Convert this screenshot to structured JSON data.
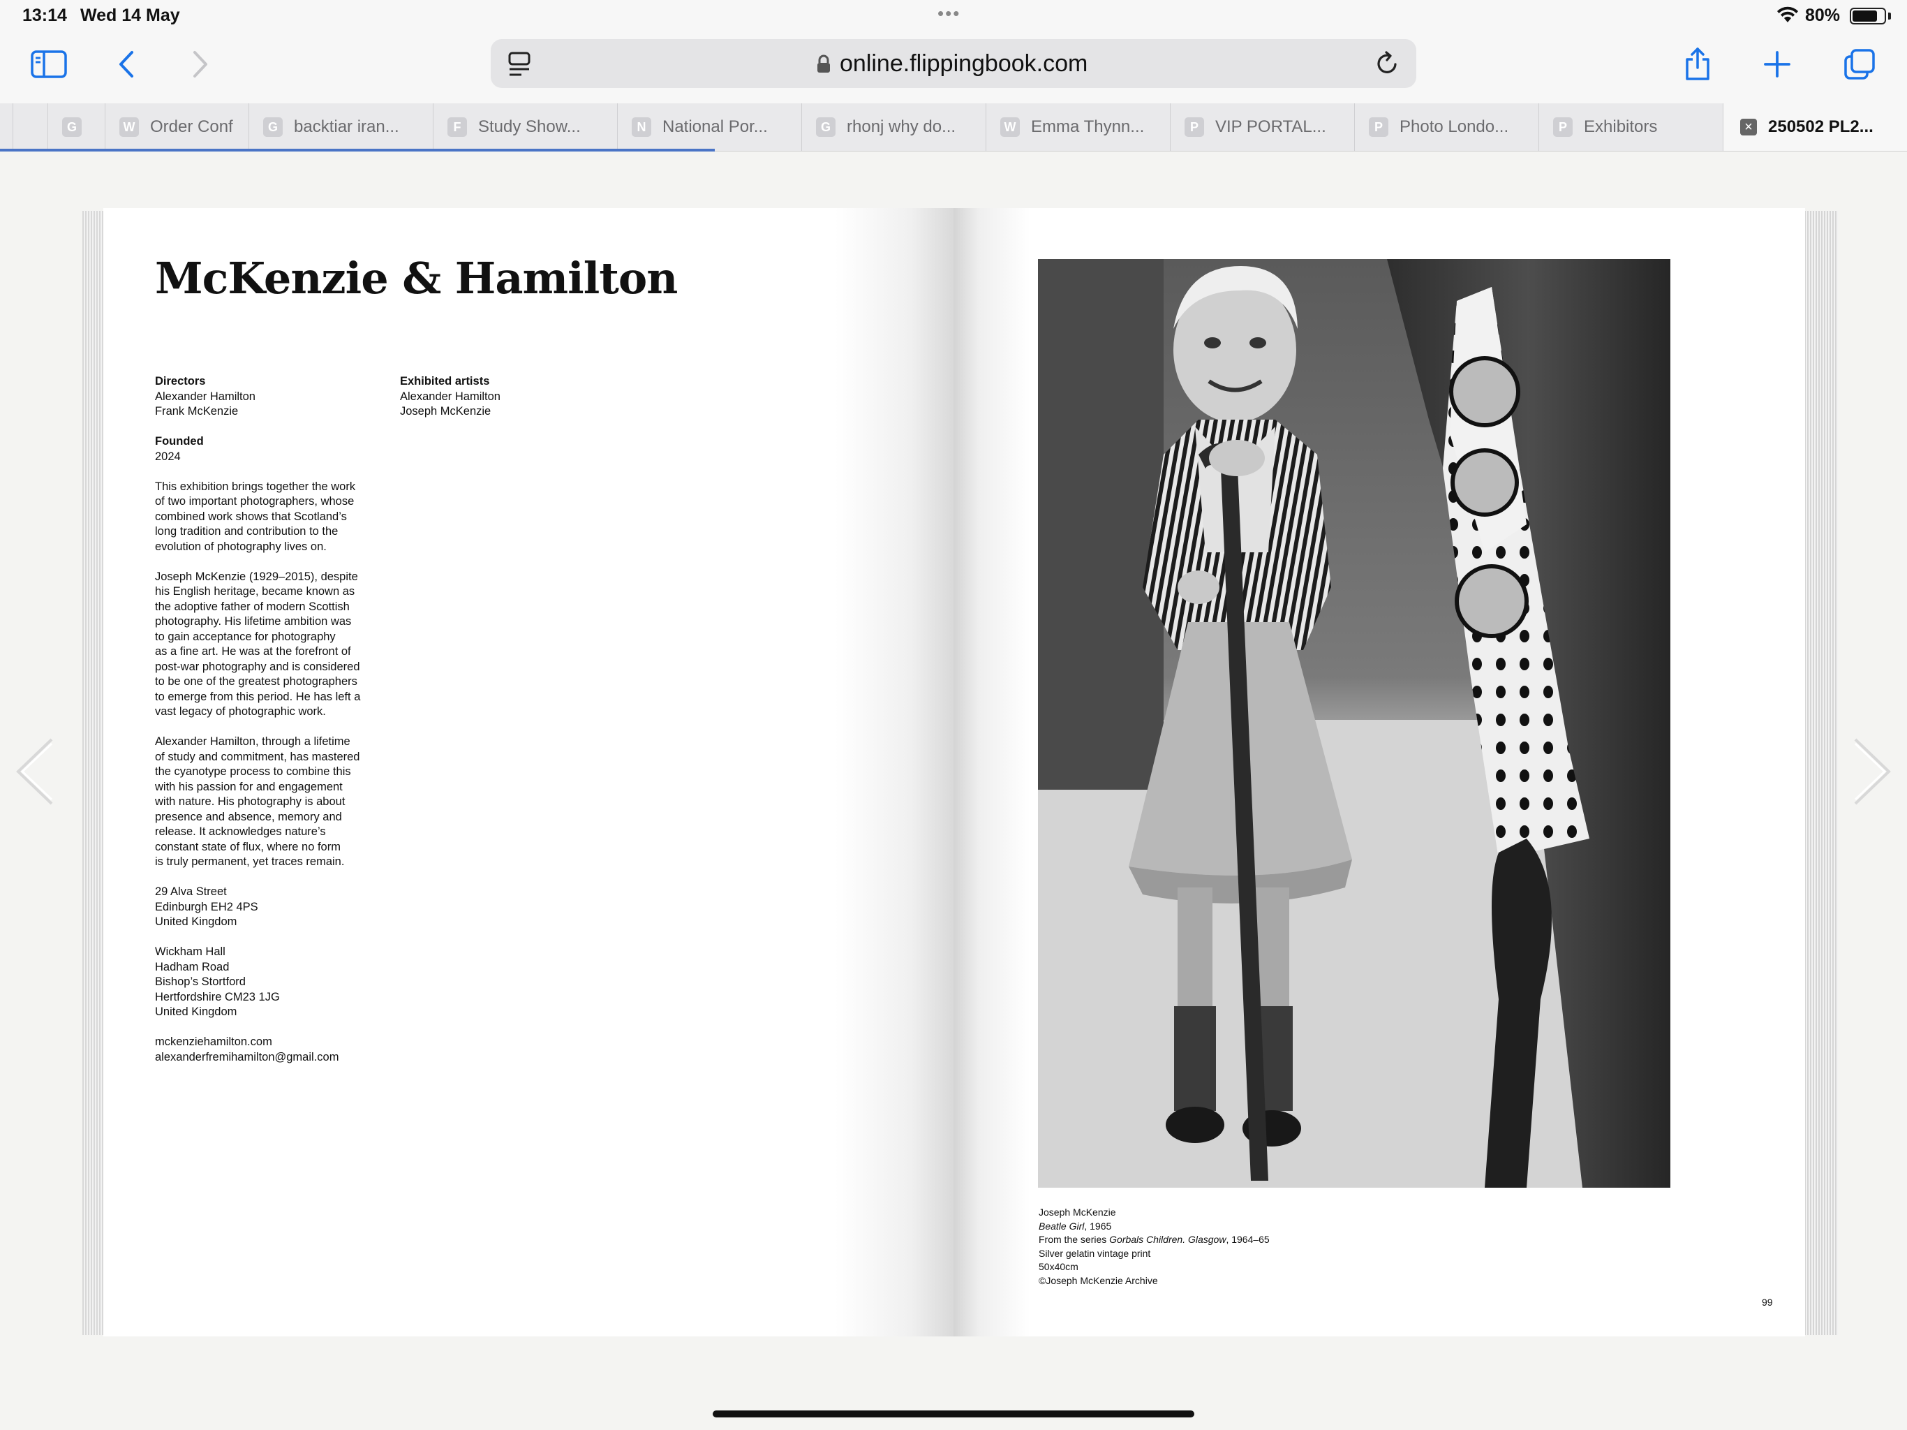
{
  "status": {
    "time": "13:14",
    "date": "Wed 14 May",
    "battery": "80%",
    "battery_level": 0.8
  },
  "browser": {
    "url": "online.flippingbook.com",
    "accent": "#1a73e8",
    "tabs": [
      {
        "fav": "",
        "label": ""
      },
      {
        "fav": "G",
        "label": ""
      },
      {
        "fav": "W",
        "label": "Order Conf"
      },
      {
        "fav": "G",
        "label": "backtiar iran..."
      },
      {
        "fav": "F",
        "label": "Study Show..."
      },
      {
        "fav": "N",
        "label": "National Por..."
      },
      {
        "fav": "G",
        "label": "rhonj why do..."
      },
      {
        "fav": "W",
        "label": "Emma Thynn..."
      },
      {
        "fav": "P",
        "label": "VIP PORTAL..."
      },
      {
        "fav": "P",
        "label": "Photo Londo..."
      },
      {
        "fav": "P",
        "label": "Exhibitors"
      },
      {
        "fav": "×",
        "label": "250502 PL2..."
      }
    ]
  },
  "book": {
    "title": "McKenzie & Hamilton",
    "directors_head": "Directors",
    "directors": [
      "Alexander Hamilton",
      "Frank McKenzie"
    ],
    "founded_head": "Founded",
    "founded": "2024",
    "artists_head": "Exhibited artists",
    "artists": [
      "Alexander Hamilton",
      "Joseph McKenzie"
    ],
    "para1": [
      "This exhibition brings together the work",
      "of two important photographers, whose",
      "combined work shows that Scotland’s",
      "long tradition and contribution to the",
      "evolution of photography lives on."
    ],
    "para2": [
      "Joseph McKenzie (1929–2015), despite",
      "his English heritage, became known as",
      "the adoptive father of modern Scottish",
      "photography. His lifetime ambition was",
      "to gain acceptance for photography",
      "as a fine art. He was at the forefront of",
      "post-war photography and is considered",
      "to be one of the greatest photographers",
      "to emerge from this period. He has left a",
      "vast legacy of photographic work."
    ],
    "para3": [
      "Alexander Hamilton, through a lifetime",
      "of study and commitment, has mastered",
      "the cyanotype process to combine this",
      "with his passion for and engagement",
      "with nature. His photography is about",
      "presence and absence, memory and",
      "release. It acknowledges nature’s",
      "constant state of flux, where no form",
      "is truly permanent, yet traces remain."
    ],
    "address1": [
      "29 Alva Street",
      "Edinburgh EH2 4PS",
      "United Kingdom"
    ],
    "address2": [
      "Wickham Hall",
      "Hadham Road",
      "Bishop’s Stortford",
      "Hertfordshire CM23 1JG",
      "United Kingdom"
    ],
    "web": "mckenziehamilton.com",
    "email": "alexanderfremihamilton@gmail.com",
    "caption": {
      "artist": "Joseph McKenzie",
      "work_title": "Beatle Girl",
      "work_year": ", 1965",
      "series_prefix": "From the series ",
      "series": "Gorbals Children. Glasgow",
      "series_year": ", 1964–65",
      "medium": "Silver gelatin vintage print",
      "size": "50x40cm",
      "credit": "©Joseph McKenzie Archive"
    },
    "page_number": "99"
  }
}
